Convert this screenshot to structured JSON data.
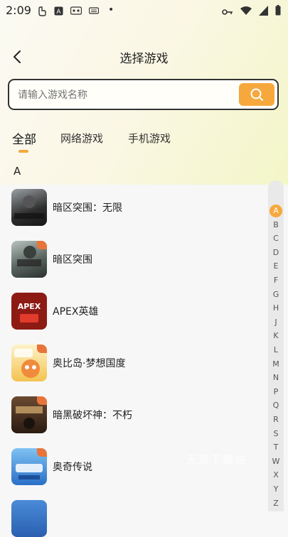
{
  "status": {
    "time": "2:09",
    "dot": "•"
  },
  "header": {
    "title": "选择游戏"
  },
  "search": {
    "placeholder": "请输入游戏名称"
  },
  "tabs": [
    {
      "label": "全部"
    },
    {
      "label": "网络游戏"
    },
    {
      "label": "手机游戏"
    }
  ],
  "section": {
    "letter": "A"
  },
  "games": [
    {
      "name": "暗区突围：无限",
      "art": "暗区突围 无限",
      "color": "#3a3a3a"
    },
    {
      "name": "暗区突围",
      "art": "暗区突围",
      "color": "#4a5550"
    },
    {
      "name": "APEX英雄",
      "art": "APEX\n英雄",
      "color": "#b3261e"
    },
    {
      "name": "奥比岛·梦想国度",
      "art": "奥比岛",
      "color": "#f2d15b"
    },
    {
      "name": "暗黑破坏神：不朽",
      "art": "暗黑破坏神",
      "color": "#3b2a20"
    },
    {
      "name": "奥奇传说",
      "art": "奥奇传说",
      "color": "#2d7fd6"
    }
  ],
  "index_letters": [
    "A",
    "B",
    "C",
    "D",
    "E",
    "F",
    "G",
    "H",
    "J",
    "K",
    "L",
    "M",
    "N",
    "P",
    "Q",
    "R",
    "S",
    "T",
    "W",
    "X",
    "Y",
    "Z"
  ],
  "watermark": "天道下载站",
  "accent": "#f7a83c"
}
